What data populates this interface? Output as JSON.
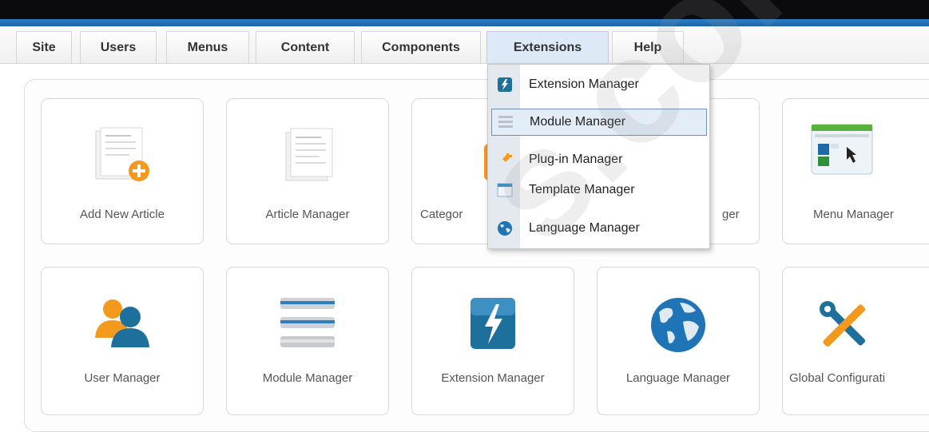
{
  "menu": {
    "items": [
      {
        "label": "Site"
      },
      {
        "label": "Users"
      },
      {
        "label": "Menus"
      },
      {
        "label": "Content"
      },
      {
        "label": "Components"
      },
      {
        "label": "Extensions"
      },
      {
        "label": "Help"
      }
    ],
    "active": "Extensions"
  },
  "dropdown": {
    "items": [
      {
        "label": "Extension Manager",
        "icon": "extension-manager-icon"
      },
      {
        "label": "Module Manager",
        "icon": "module-manager-icon"
      },
      {
        "label": "Plug-in Manager",
        "icon": "plugin-manager-icon"
      },
      {
        "label": "Template Manager",
        "icon": "template-manager-icon"
      },
      {
        "label": "Language Manager",
        "icon": "language-manager-icon"
      }
    ],
    "selected": "Module Manager"
  },
  "quickicons": {
    "row1": [
      {
        "label": "Add New Article"
      },
      {
        "label": "Article Manager"
      },
      {
        "label": "Categor"
      },
      {
        "label": "ger"
      },
      {
        "label": "Menu Manager"
      }
    ],
    "row2": [
      {
        "label": "User Manager"
      },
      {
        "label": "Module Manager"
      },
      {
        "label": "Extension Manager"
      },
      {
        "label": "Language Manager"
      },
      {
        "label": "Global Configurati"
      }
    ]
  },
  "watermark": "s.com",
  "colors": {
    "topbar": "#0b0b0f",
    "bluebar": "#2b7ec9",
    "accent": "#1d6f9c",
    "orange": "#f39a1e"
  }
}
